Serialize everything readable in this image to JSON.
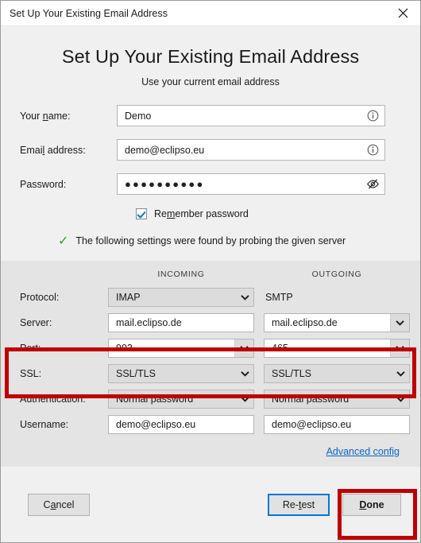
{
  "window": {
    "title": "Set Up Your Existing Email Address",
    "close_icon": "close-icon"
  },
  "header": {
    "title": "Set Up Your Existing Email Address",
    "subtitle": "Use your current email address"
  },
  "form": {
    "name": {
      "label_pre": "Your ",
      "label_accel": "n",
      "label_post": "ame:",
      "value": "Demo",
      "icon": "info-icon"
    },
    "email": {
      "label_pre": "Emai",
      "label_accel": "l",
      "label_post": " address:",
      "value": "demo@eclipso.eu",
      "icon": "info-icon"
    },
    "password": {
      "label": "Password:",
      "value": "●●●●●●●●●●",
      "icon": "eye-slash-icon"
    },
    "remember": {
      "label_pre": "Re",
      "label_accel": "m",
      "label_post": "ember password",
      "checked": true
    },
    "probe_message": "The following settings were found by probing the given server",
    "probe_icon": "green-check-icon"
  },
  "settings": {
    "columns": {
      "incoming": "INCOMING",
      "outgoing": "OUTGOING"
    },
    "rows": [
      {
        "label": "Protocol:",
        "incoming": {
          "type": "select",
          "value": "IMAP"
        },
        "outgoing": {
          "type": "text",
          "value": "SMTP"
        }
      },
      {
        "label": "Server:",
        "incoming": {
          "type": "input",
          "value": "mail.eclipso.de"
        },
        "outgoing": {
          "type": "combo",
          "value": "mail.eclipso.de"
        }
      },
      {
        "label": "Port:",
        "incoming": {
          "type": "combo",
          "value": "993"
        },
        "outgoing": {
          "type": "combo",
          "value": "465"
        }
      },
      {
        "label": "SSL:",
        "incoming": {
          "type": "select",
          "value": "SSL/TLS"
        },
        "outgoing": {
          "type": "select",
          "value": "SSL/TLS"
        }
      },
      {
        "label": "Authentication:",
        "incoming": {
          "type": "select",
          "value": "Normal password"
        },
        "outgoing": {
          "type": "select",
          "value": "Normal password"
        }
      },
      {
        "label": "Username:",
        "incoming": {
          "type": "input",
          "value": "demo@eclipso.eu"
        },
        "outgoing": {
          "type": "input",
          "value": "demo@eclipso.eu"
        }
      }
    ],
    "advanced_link": {
      "label_accel": "A",
      "label_post": "dvanced config"
    }
  },
  "footer": {
    "cancel": {
      "pre": "C",
      "accel": "a",
      "post": "ncel"
    },
    "retest": {
      "pre": "Re-",
      "accel": "t",
      "post": "est"
    },
    "done": {
      "accel": "D",
      "post": "one"
    }
  },
  "annotations": {
    "highlight_color": "#c00000",
    "boxes": [
      "port-ssl-rows",
      "done-button"
    ]
  }
}
